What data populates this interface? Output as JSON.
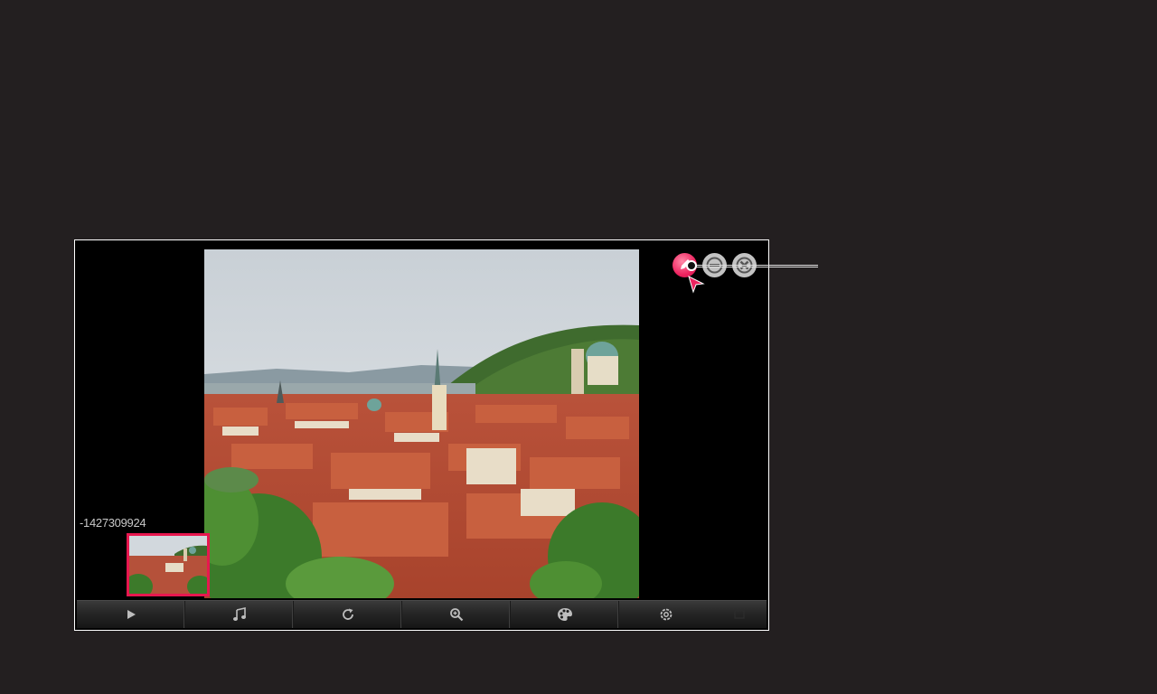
{
  "viewer": {
    "file_name": "-1427309924"
  },
  "top_controls": {
    "active_index": 0,
    "buttons": [
      {
        "icon": "pencil-icon"
      },
      {
        "icon": "minimize-icon"
      },
      {
        "icon": "close-icon"
      }
    ]
  },
  "toolbar": {
    "buttons": [
      {
        "icon": "play-icon"
      },
      {
        "icon": "music-note-icon"
      },
      {
        "icon": "rotate-icon"
      },
      {
        "icon": "zoom-in-icon"
      },
      {
        "icon": "palette-icon"
      },
      {
        "icon": "settings-icon"
      }
    ]
  },
  "colors": {
    "background": "#231f20",
    "accent": "#e8174f",
    "frame_border": "#ffffff"
  }
}
